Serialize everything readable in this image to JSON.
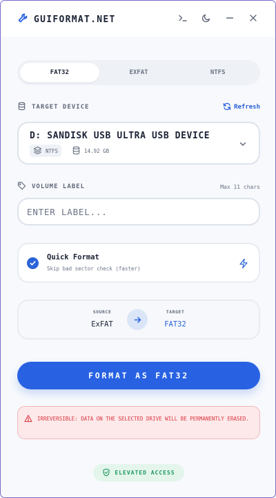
{
  "app": {
    "title": "GUIFORMAT.NET"
  },
  "window_controls": {
    "icons": [
      "terminal-icon",
      "moon-icon",
      "minimize-icon",
      "close-icon"
    ]
  },
  "tabs": [
    {
      "label": "FAT32",
      "active": true
    },
    {
      "label": "EXFAT",
      "active": false
    },
    {
      "label": "NTFS",
      "active": false
    }
  ],
  "target_device": {
    "section_label": "TARGET DEVICE",
    "refresh_label": "Refresh",
    "device_name": "D: SANDISK USB ULTRA USB DEVICE",
    "filesystem": "NTFS",
    "size": "14.92 GB"
  },
  "volume_label": {
    "section_label": "VOLUME LABEL",
    "hint": "Max 11 chars",
    "value": "",
    "placeholder": "ENTER LABEL..."
  },
  "quick_format": {
    "title": "Quick Format",
    "subtitle": "Skip bad sector check (faster)",
    "checked": true
  },
  "conversion": {
    "source_caption": "SOURCE",
    "source_value": "ExFAT",
    "target_caption": "TARGET",
    "target_value": "FAT32"
  },
  "primary_action": {
    "label": "FORMAT AS FAT32"
  },
  "warning": {
    "text": "IRREVERSIBLE: DATA ON THE SELECTED DRIVE WILL BE PERMANENTLY ERASED."
  },
  "status_badge": {
    "label": "ELEVATED ACCESS"
  },
  "colors": {
    "accent": "#2862e3",
    "danger": "#d9363e",
    "success": "#1f9a5e",
    "frame": "#7a68c8"
  }
}
